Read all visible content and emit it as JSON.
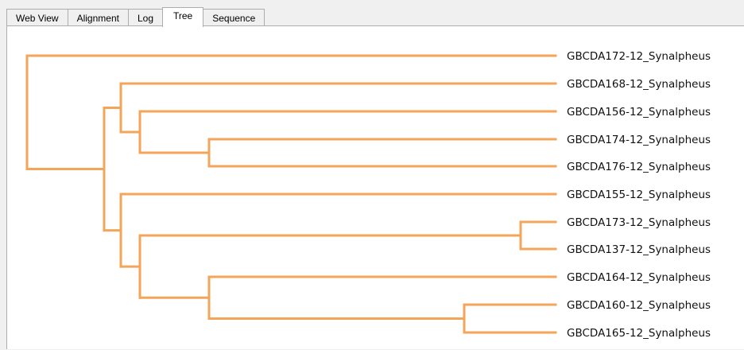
{
  "tabs": [
    {
      "label": "Web View",
      "active": false
    },
    {
      "label": "Alignment",
      "active": false
    },
    {
      "label": "Log",
      "active": false
    },
    {
      "label": "Tree",
      "active": true
    },
    {
      "label": "Sequence",
      "active": false
    }
  ],
  "tree": {
    "branch_color": "#f3a65a",
    "leaves": [
      "GBCDA172-12_Synalpheus",
      "GBCDA168-12_Synalpheus",
      "GBCDA156-12_Synalpheus",
      "GBCDA174-12_Synalpheus",
      "GBCDA176-12_Synalpheus",
      "GBCDA155-12_Synalpheus",
      "GBCDA173-12_Synalpheus",
      "GBCDA137-12_Synalpheus",
      "GBCDA164-12_Synalpheus",
      "GBCDA160-12_Synalpheus",
      "GBCDA165-12_Synalpheus"
    ]
  }
}
